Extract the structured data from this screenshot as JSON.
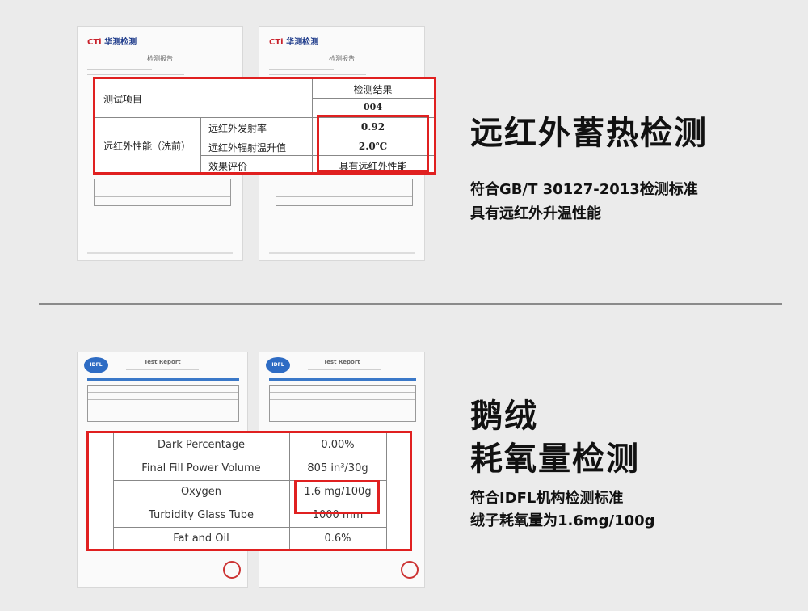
{
  "section1": {
    "doc_logo_mark": "CTi",
    "doc_logo_name": "华测检测",
    "doc_title": "检测报告",
    "table": {
      "header_item": "测试项目",
      "header_result": "检测结果",
      "report_no": "004",
      "group_label": "远红外性能（洗前）",
      "rows": [
        {
          "label": "远红外发射率",
          "value": "0.92"
        },
        {
          "label": "远红外辐射温升值",
          "value": "2.0℃"
        },
        {
          "label": "效果评价",
          "value": "具有远红外性能"
        }
      ]
    },
    "heading": "远红外蓄热检测",
    "desc_line1": "符合GB/T 30127-2013检测标准",
    "desc_line2": "具有远红外升温性能"
  },
  "section2": {
    "doc_logo": "IDFL",
    "doc_title": "Test Report",
    "table": {
      "rows": [
        {
          "label": "Dark Percentage",
          "value": "0.00%"
        },
        {
          "label": "Final Fill Power Volume",
          "value": "805 in³/30g"
        },
        {
          "label": "Oxygen",
          "value": "1.6 mg/100g"
        },
        {
          "label": "Turbidity Glass Tube",
          "value": "1000 mm"
        },
        {
          "label": "Fat and Oil",
          "value": "0.6%"
        }
      ]
    },
    "heading_line1": "鹅绒",
    "heading_line2": "耗氧量检测",
    "desc_line1": "符合IDFL机构检测标准",
    "desc_line2": "绒子耗氧量为1.6mg/100g"
  },
  "colors": {
    "highlight": "#e02020",
    "background": "#ebebeb",
    "cti_blue": "#1d3a8a",
    "cti_red": "#c8202a"
  }
}
